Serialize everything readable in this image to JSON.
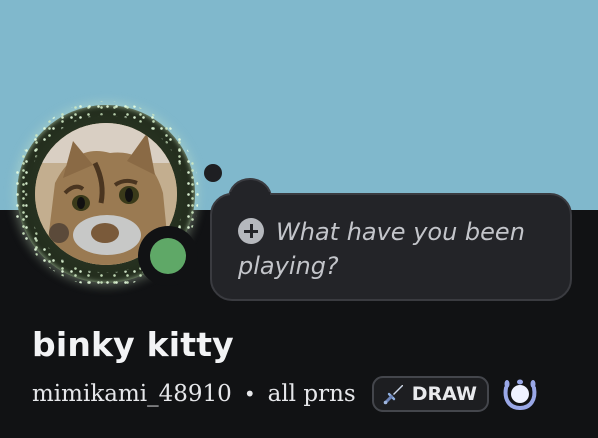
{
  "profile": {
    "display_name": "binky kitty",
    "username": "mimikami_48910",
    "separator": "•",
    "pronouns": "all prns",
    "status": "online"
  },
  "custom_status": {
    "placeholder": "What have you been playing?",
    "icon": "plus-circle-icon"
  },
  "guild_tag": {
    "label": "DRAW",
    "icon": "sword-icon"
  },
  "badges": [
    {
      "icon": "laurel-wreath-icon"
    }
  ],
  "colors": {
    "banner": "#80b8cc",
    "card_background": "#111214",
    "status_online": "#5fa867",
    "laurel": "#9aa8e8"
  }
}
